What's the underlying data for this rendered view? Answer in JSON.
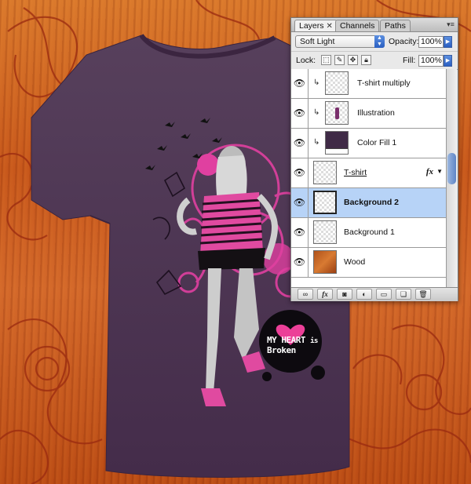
{
  "panel": {
    "tabs": [
      {
        "label": "Layers",
        "close": "✕"
      },
      {
        "label": "Channels"
      },
      {
        "label": "Paths"
      }
    ],
    "menu_icon": "panel-menu-icon",
    "blend_mode": "Soft Light",
    "opacity_label": "Opacity:",
    "opacity_value": "100%",
    "lock_label": "Lock:",
    "fill_label": "Fill:",
    "fill_value": "100%"
  },
  "layers": [
    {
      "name": "T-shirt multiply",
      "clipped": true,
      "thumb": "transparent",
      "selected": false
    },
    {
      "name": "Illustration",
      "clipped": true,
      "thumb": "transparent",
      "selected": false
    },
    {
      "name": "Color Fill 1",
      "clipped": true,
      "thumb": "fill",
      "selected": false
    },
    {
      "name": "T-shirt",
      "clipped": false,
      "thumb": "transparent",
      "selected": false,
      "fx": "fx"
    },
    {
      "name": "Background 2",
      "clipped": false,
      "thumb": "transparent",
      "selected": true
    },
    {
      "name": "Background 1",
      "clipped": false,
      "thumb": "transparent",
      "selected": false
    },
    {
      "name": "Wood",
      "clipped": false,
      "thumb": "wood",
      "selected": false
    }
  ],
  "artwork": {
    "logo_text": [
      "MY",
      "HEART",
      "is",
      "Broken"
    ],
    "shirt_color": "#4b3350",
    "accent_color": "#e040a0"
  },
  "colors": {
    "selection": "#b7d3f7",
    "wood": "#c6561b"
  }
}
